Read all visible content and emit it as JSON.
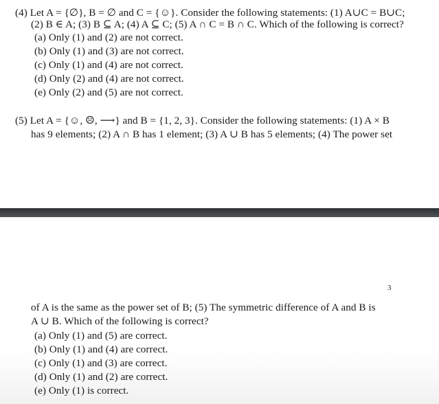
{
  "document": {
    "top_page": {
      "question4": {
        "lines": [
          "(4) Let A = {∅}, B = ∅ and C = {☺}. Consider the following statements: (1) A∪C = B∪C;",
          "(2) B ∈ A; (3) B ⊆ A; (4) A ⊆ C; (5) A ∩ C = B ∩ C. Which of the following is correct?"
        ],
        "options": [
          "(a) Only (1) and (2) are not correct.",
          "(b) Only (1) and (3) are not correct.",
          "(c) Only (1) and (4) are not correct.",
          "(d) Only (2) and (4) are not correct.",
          "(e) Only (2) and (5) are not correct."
        ]
      },
      "question5_start": {
        "lines": [
          "(5) Let A = {☺, ☹, ⟶} and B = {1, 2, 3}. Consider the following statements: (1) A × B",
          "has 9 elements; (2) A ∩ B has 1 element; (3) A ∪ B has 5 elements; (4) The power set"
        ]
      }
    },
    "bottom_page": {
      "page_number": "3",
      "question5_continued": {
        "lines": [
          "of A is the same as the power set of B; (5) The symmetric difference of A and B is",
          "A ∪ B. Which of the following is correct?"
        ],
        "options": [
          "(a) Only (1) and (5) are correct.",
          "(b) Only (1) and (4) are correct.",
          "(c) Only (1) and (3) are correct.",
          "(d) Only (1) and (2) are correct.",
          "(e) Only (1) is correct."
        ]
      }
    }
  }
}
